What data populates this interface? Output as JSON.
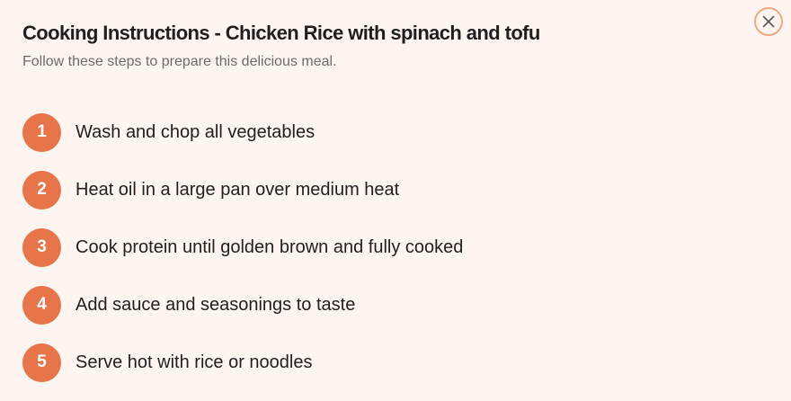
{
  "dialog": {
    "title": "Cooking Instructions - Chicken Rice with spinach and tofu",
    "subtitle": "Follow these steps to prepare this delicious meal.",
    "close_icon": "close-icon"
  },
  "steps": [
    {
      "number": "1",
      "text": "Wash and chop all vegetables"
    },
    {
      "number": "2",
      "text": "Heat oil in a large pan over medium heat"
    },
    {
      "number": "3",
      "text": "Cook protein until golden brown and fully cooked"
    },
    {
      "number": "4",
      "text": "Add sauce and seasonings to taste"
    },
    {
      "number": "5",
      "text": "Serve hot with rice or noodles"
    }
  ],
  "colors": {
    "background": "#fff5f0",
    "accent": "#e8754a",
    "close_border": "#f0a882",
    "text": "#1f1f1f",
    "muted_text": "#6b6b6b"
  }
}
